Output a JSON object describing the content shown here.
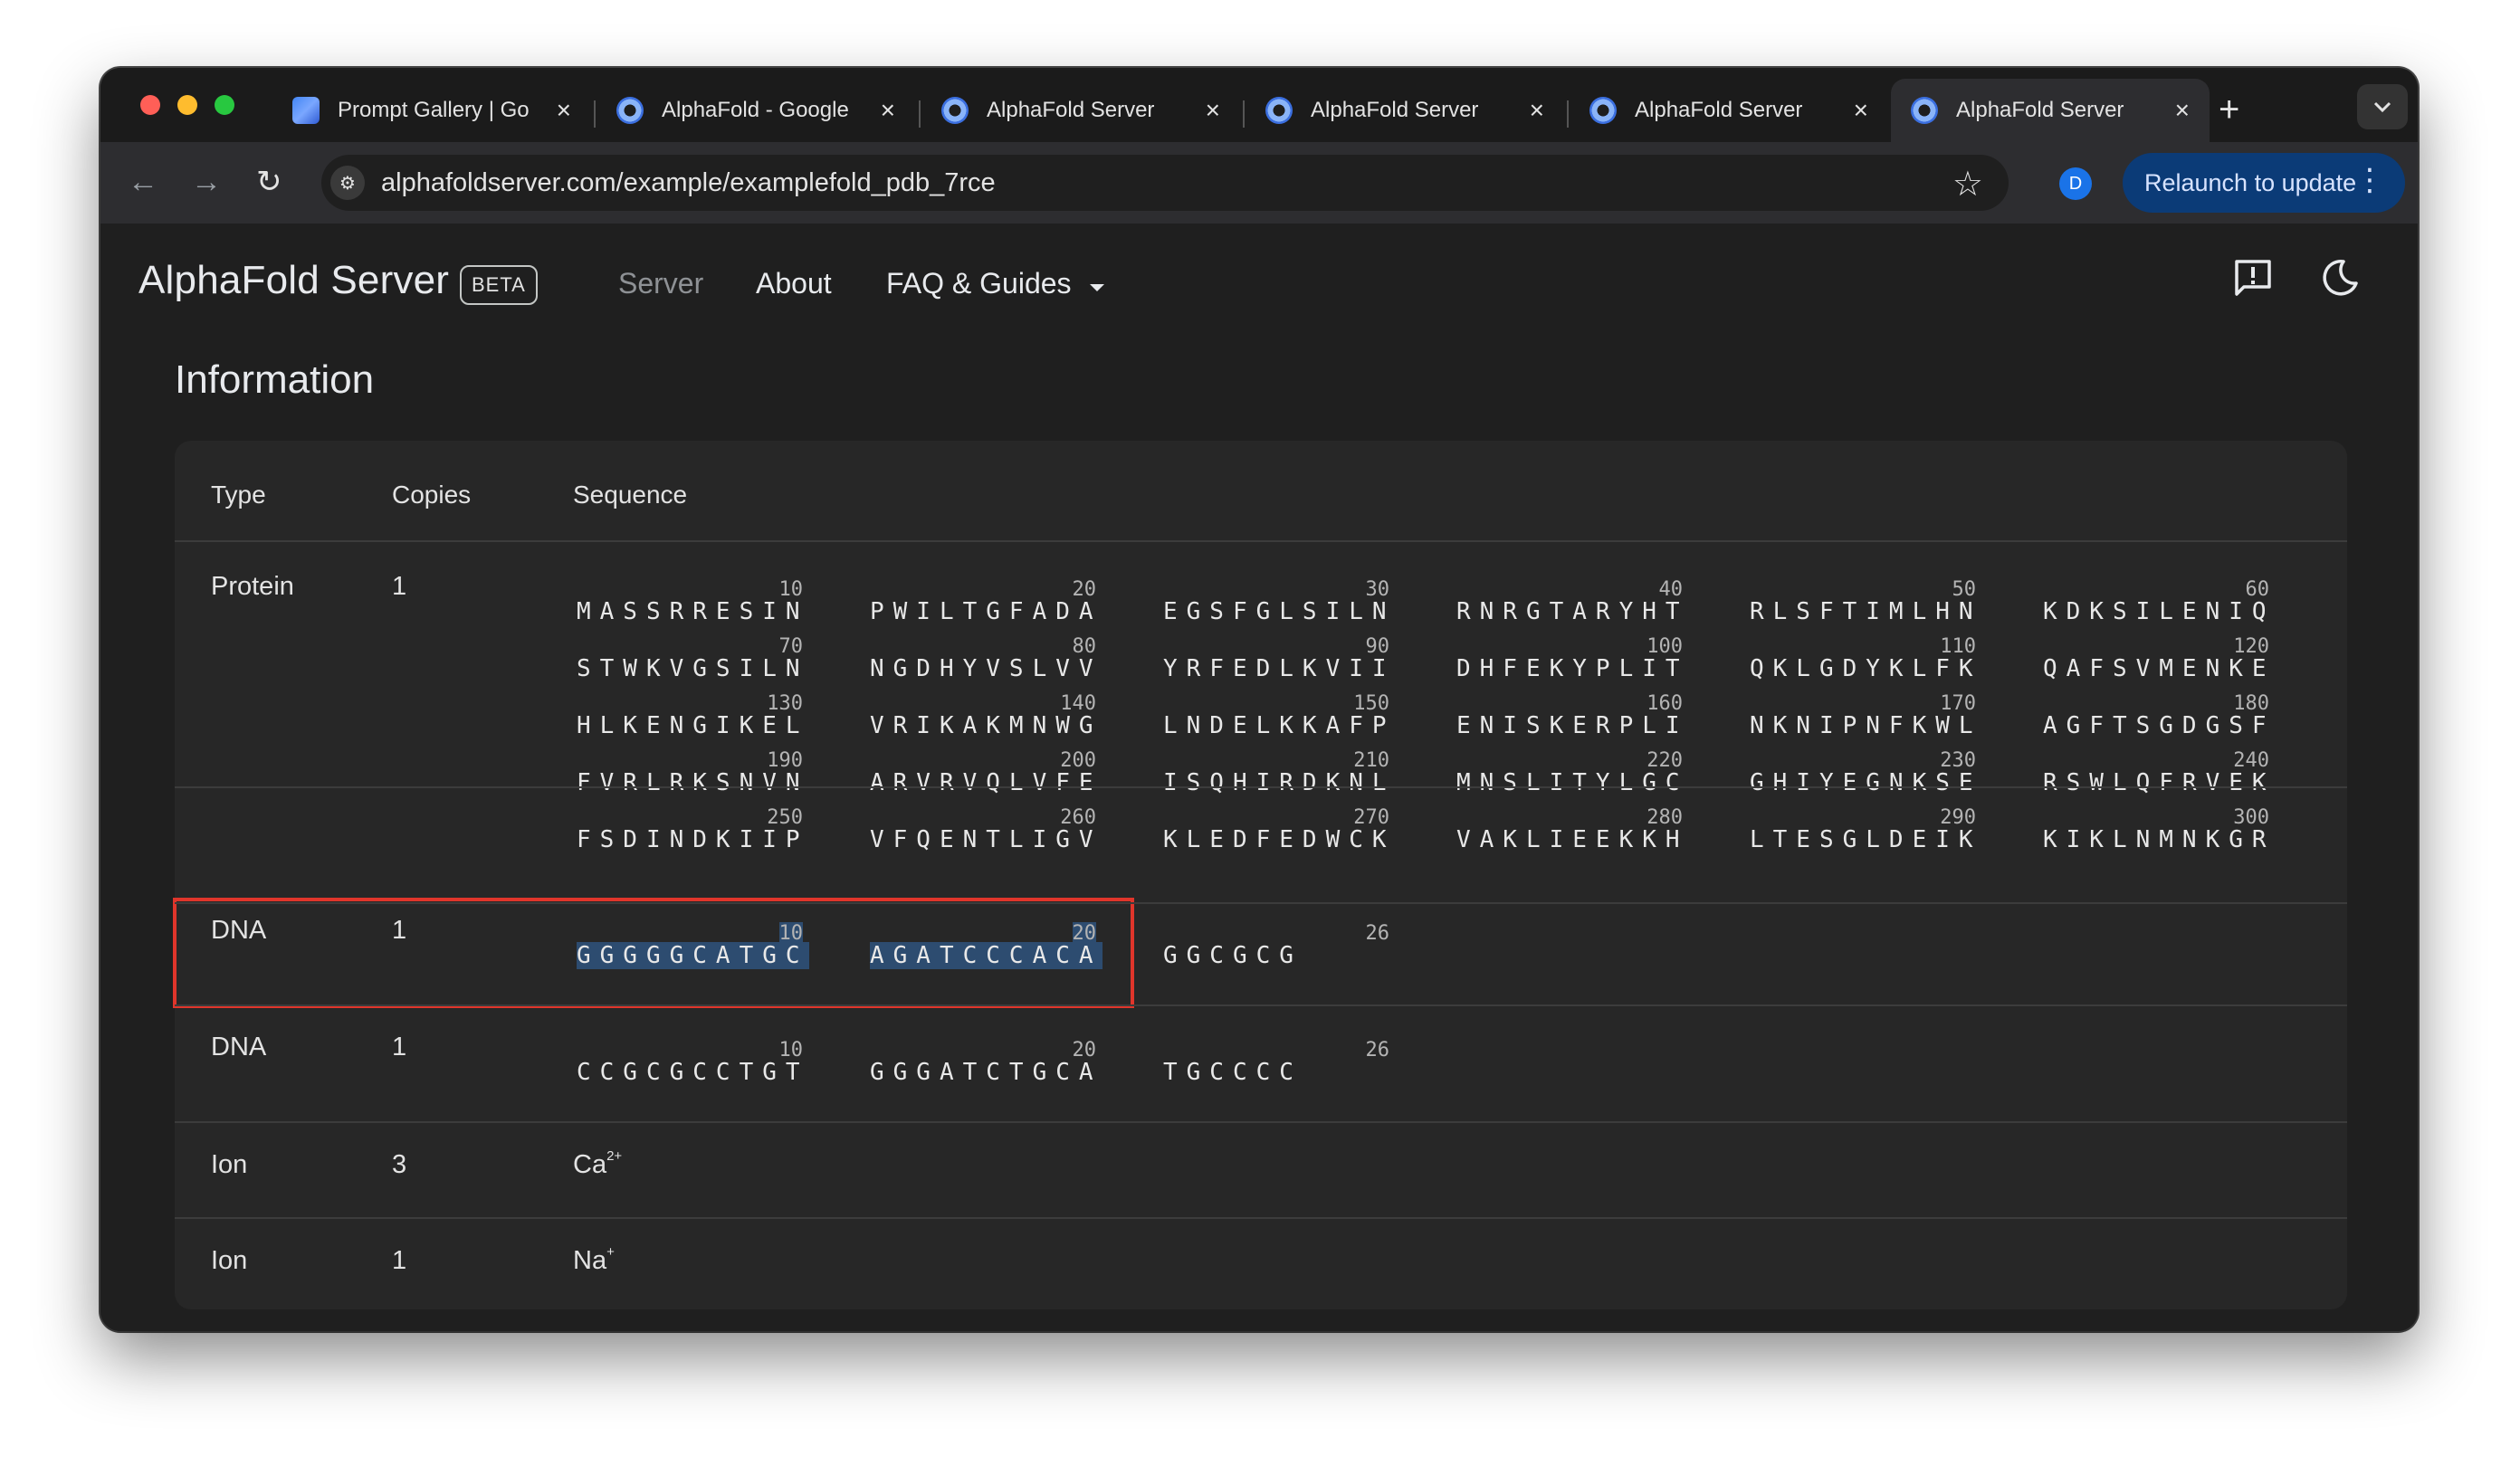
{
  "browser": {
    "tabs": [
      {
        "title": "Prompt Gallery | Go",
        "active": false
      },
      {
        "title": "AlphaFold - Google",
        "active": false
      },
      {
        "title": "AlphaFold Server",
        "active": false
      },
      {
        "title": "AlphaFold Server",
        "active": false
      },
      {
        "title": "AlphaFold Server",
        "active": false
      },
      {
        "title": "AlphaFold Server",
        "active": true
      }
    ],
    "url": "alphafoldserver.com/example/examplefold_pdb_7rce",
    "profile_initial": "D",
    "relaunch_label": "Relaunch to update",
    "colors": {
      "close": "#ff5f57",
      "minimize": "#febc2e",
      "maximize": "#28c840",
      "relaunch_bg": "#0b3b77"
    }
  },
  "app": {
    "brand": "AlphaFold Server",
    "badge": "BETA",
    "nav": {
      "server": "Server",
      "about": "About",
      "faq": "FAQ & Guides"
    },
    "section_title": "Information",
    "table": {
      "headers": {
        "type": "Type",
        "copies": "Copies",
        "sequence": "Sequence"
      },
      "rows": [
        {
          "type": "Protein",
          "copies": "1",
          "chunks": [
            {
              "n": "10",
              "s": "MASSRRESIN"
            },
            {
              "n": "20",
              "s": "PWILTGFADA"
            },
            {
              "n": "30",
              "s": "EGSFGLSILN"
            },
            {
              "n": "40",
              "s": "RNRGTARYHT"
            },
            {
              "n": "50",
              "s": "RLSFTIMLHN"
            },
            {
              "n": "60",
              "s": "KDKSILENIQ"
            },
            {
              "n": "70",
              "s": "STWKVGSILN"
            },
            {
              "n": "80",
              "s": "NGDHYVSLVV"
            },
            {
              "n": "90",
              "s": "YRFEDLKVII"
            },
            {
              "n": "100",
              "s": "DHFEKYPLIT"
            },
            {
              "n": "110",
              "s": "QKLGDYKLFK"
            },
            {
              "n": "120",
              "s": "QAFSVMENKE"
            },
            {
              "n": "130",
              "s": "HLKENGIKEL"
            },
            {
              "n": "140",
              "s": "VRIKAKMNWG"
            },
            {
              "n": "150",
              "s": "LNDELKKAFP"
            },
            {
              "n": "160",
              "s": "ENISKERPLI"
            },
            {
              "n": "170",
              "s": "NKNIPNFKWL"
            },
            {
              "n": "180",
              "s": "AGFTSGDGSF"
            },
            {
              "n": "190",
              "s": "FVRLRKSNVN"
            },
            {
              "n": "200",
              "s": "ARVRVQLVFE"
            },
            {
              "n": "210",
              "s": "ISQHIRDKNL"
            },
            {
              "n": "220",
              "s": "MNSLITYLGC"
            },
            {
              "n": "230",
              "s": "GHIYEGNKSE"
            },
            {
              "n": "240",
              "s": "RSWLQFRVEK"
            },
            {
              "n": "250",
              "s": "FSDINDKIIP"
            },
            {
              "n": "260",
              "s": "VFQENTLIGV"
            },
            {
              "n": "270",
              "s": "KLEDFEDWCK"
            },
            {
              "n": "280",
              "s": "VAKLIEEKKH"
            },
            {
              "n": "290",
              "s": "LTESGLDEIK"
            },
            {
              "n": "300",
              "s": "KIKLNMNKGR"
            }
          ]
        },
        {
          "type": "DNA",
          "copies": "1",
          "chunks": [
            {
              "n": "10",
              "s": "GGGGGCATGC",
              "hl": true
            },
            {
              "n": "20",
              "s": "AGATCCCACA",
              "hl": true
            },
            {
              "n": "26",
              "s": "GGCGCG"
            }
          ]
        },
        {
          "type": "DNA",
          "copies": "1",
          "chunks": [
            {
              "n": "10",
              "s": "CCGCGCCTGT"
            },
            {
              "n": "20",
              "s": "GGGATCTGCA"
            },
            {
              "n": "26",
              "s": "TGCCCC"
            }
          ]
        },
        {
          "type": "Ion",
          "copies": "3",
          "ion_symbol": "Ca",
          "ion_charge": "2+"
        },
        {
          "type": "Ion",
          "copies": "1",
          "ion_symbol": "Na",
          "ion_charge": "+"
        }
      ]
    }
  }
}
